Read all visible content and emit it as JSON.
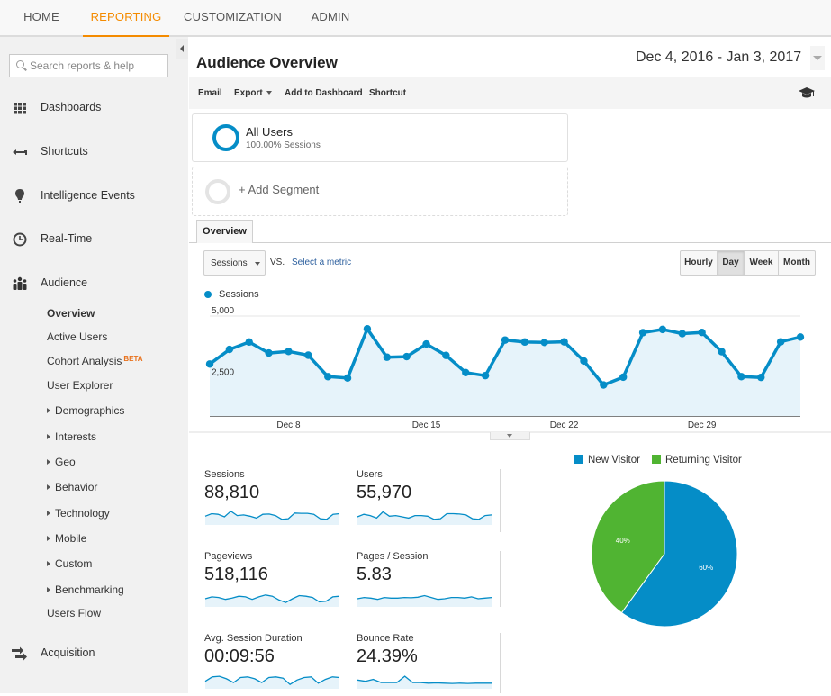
{
  "topnav": {
    "tabs": [
      {
        "label": "HOME",
        "active": false
      },
      {
        "label": "REPORTING",
        "active": true
      },
      {
        "label": "CUSTOMIZATION",
        "active": false
      },
      {
        "label": "ADMIN",
        "active": false
      }
    ]
  },
  "sidebar": {
    "search_placeholder": "Search reports & help",
    "sections": [
      {
        "label": "Dashboards",
        "icon": "grid-icon"
      },
      {
        "label": "Shortcuts",
        "icon": "shortcut-arrow-icon"
      },
      {
        "label": "Intelligence Events",
        "icon": "lightbulb-icon"
      },
      {
        "label": "Real-Time",
        "icon": "clock-icon"
      },
      {
        "label": "Audience",
        "icon": "people-icon"
      },
      {
        "label": "Acquisition",
        "icon": "arrows-icon"
      }
    ],
    "audience_items": [
      {
        "label": "Overview",
        "expandable": false,
        "selected": true
      },
      {
        "label": "Active Users",
        "expandable": false
      },
      {
        "label": "Cohort Analysis",
        "badge": "BETA",
        "expandable": false
      },
      {
        "label": "User Explorer",
        "expandable": false
      },
      {
        "label": "Demographics",
        "expandable": true
      },
      {
        "label": "Interests",
        "expandable": true
      },
      {
        "label": "Geo",
        "expandable": true
      },
      {
        "label": "Behavior",
        "expandable": true
      },
      {
        "label": "Technology",
        "expandable": true
      },
      {
        "label": "Mobile",
        "expandable": true
      },
      {
        "label": "Custom",
        "expandable": true
      },
      {
        "label": "Benchmarking",
        "expandable": true
      },
      {
        "label": "Users Flow",
        "expandable": false
      }
    ]
  },
  "header": {
    "title": "Audience Overview",
    "date_range": "Dec 4, 2016 - Jan 3, 2017",
    "toolbar": {
      "email": "Email",
      "export": "Export",
      "add_to_dashboard": "Add to Dashboard",
      "shortcut": "Shortcut",
      "help_icon": "graduation-cap-icon"
    }
  },
  "segments": {
    "active": {
      "name": "All Users",
      "sub": "100.00% Sessions"
    },
    "add_label": "+ Add Segment"
  },
  "tabs": {
    "overview": "Overview"
  },
  "chart_controls": {
    "metric": "Sessions",
    "vs": "VS.",
    "select_metric": "Select a metric",
    "periods": [
      {
        "label": "Hourly",
        "active": false
      },
      {
        "label": "Day",
        "active": true
      },
      {
        "label": "Week",
        "active": false
      },
      {
        "label": "Month",
        "active": false
      }
    ]
  },
  "colors": {
    "accent": "#f48b00",
    "series": "#058dc7",
    "series_fill": "#e6f3fa",
    "new_visitor": "#058dc7",
    "returning_visitor": "#50b432"
  },
  "chart_data": [
    {
      "type": "area",
      "title": "Sessions",
      "legend": [
        "Sessions"
      ],
      "x": [
        "Dec 4",
        "Dec 5",
        "Dec 6",
        "Dec 7",
        "Dec 8",
        "Dec 9",
        "Dec 10",
        "Dec 11",
        "Dec 12",
        "Dec 13",
        "Dec 14",
        "Dec 15",
        "Dec 16",
        "Dec 17",
        "Dec 18",
        "Dec 19",
        "Dec 20",
        "Dec 21",
        "Dec 22",
        "Dec 23",
        "Dec 24",
        "Dec 25",
        "Dec 26",
        "Dec 27",
        "Dec 28",
        "Dec 29",
        "Dec 30",
        "Dec 31",
        "Jan 1",
        "Jan 2",
        "Jan 3"
      ],
      "values": [
        2600,
        3330,
        3700,
        3150,
        3230,
        3040,
        1970,
        1900,
        4360,
        2940,
        2970,
        3600,
        3030,
        2170,
        2020,
        3800,
        3700,
        3680,
        3710,
        2750,
        1550,
        1940,
        4170,
        4330,
        4120,
        4180,
        3220,
        1970,
        1930,
        3710,
        3950
      ],
      "yticks": [
        "2,500",
        "5,000"
      ],
      "ytick_values": [
        2500,
        5000
      ],
      "xticks": [
        "Dec 8",
        "Dec 15",
        "Dec 22",
        "Dec 29"
      ],
      "ylim": [
        0,
        5000
      ],
      "grid": true,
      "legend_position": "top-left"
    },
    {
      "type": "pie",
      "legend": [
        "New Visitor",
        "Returning Visitor"
      ],
      "legend_position": "top",
      "slices": [
        {
          "label": "New Visitor",
          "value": 60,
          "display": "60%"
        },
        {
          "label": "Returning Visitor",
          "value": 40,
          "display": "40%"
        }
      ]
    }
  ],
  "scorecards": [
    {
      "title": "Sessions",
      "value": "88,810",
      "spark": [
        0.55,
        0.75,
        0.7,
        0.5,
        0.95,
        0.6,
        0.65,
        0.55,
        0.4,
        0.7,
        0.72,
        0.6,
        0.3,
        0.35,
        0.8,
        0.78,
        0.78,
        0.7,
        0.35,
        0.3,
        0.7,
        0.75
      ]
    },
    {
      "title": "Users",
      "value": "55,970",
      "spark": [
        0.5,
        0.7,
        0.6,
        0.4,
        0.9,
        0.55,
        0.6,
        0.5,
        0.4,
        0.6,
        0.6,
        0.55,
        0.3,
        0.35,
        0.75,
        0.75,
        0.72,
        0.65,
        0.35,
        0.3,
        0.6,
        0.65
      ]
    },
    {
      "title": "Pageviews",
      "value": "518,116",
      "spark": [
        0.5,
        0.65,
        0.6,
        0.45,
        0.55,
        0.7,
        0.65,
        0.45,
        0.65,
        0.8,
        0.7,
        0.4,
        0.2,
        0.5,
        0.75,
        0.7,
        0.6,
        0.25,
        0.3,
        0.65,
        0.7
      ]
    },
    {
      "title": "Pages / Session",
      "value": "5.83",
      "spark": [
        0.5,
        0.6,
        0.55,
        0.45,
        0.6,
        0.55,
        0.55,
        0.6,
        0.58,
        0.62,
        0.75,
        0.6,
        0.45,
        0.5,
        0.6,
        0.6,
        0.55,
        0.65,
        0.5,
        0.55,
        0.6
      ]
    },
    {
      "title": "Avg. Session Duration",
      "value": "00:09:56",
      "spark": [
        0.45,
        0.8,
        0.85,
        0.65,
        0.35,
        0.75,
        0.8,
        0.65,
        0.35,
        0.75,
        0.8,
        0.7,
        0.2,
        0.55,
        0.75,
        0.8,
        0.3,
        0.6,
        0.8,
        0.75
      ]
    },
    {
      "title": "Bounce Rate",
      "value": "24.39%",
      "spark": [
        0.55,
        0.45,
        0.6,
        0.35,
        0.35,
        0.35,
        0.85,
        0.35,
        0.35,
        0.3,
        0.32,
        0.3,
        0.28,
        0.3,
        0.28,
        0.3,
        0.3,
        0.3
      ]
    }
  ]
}
